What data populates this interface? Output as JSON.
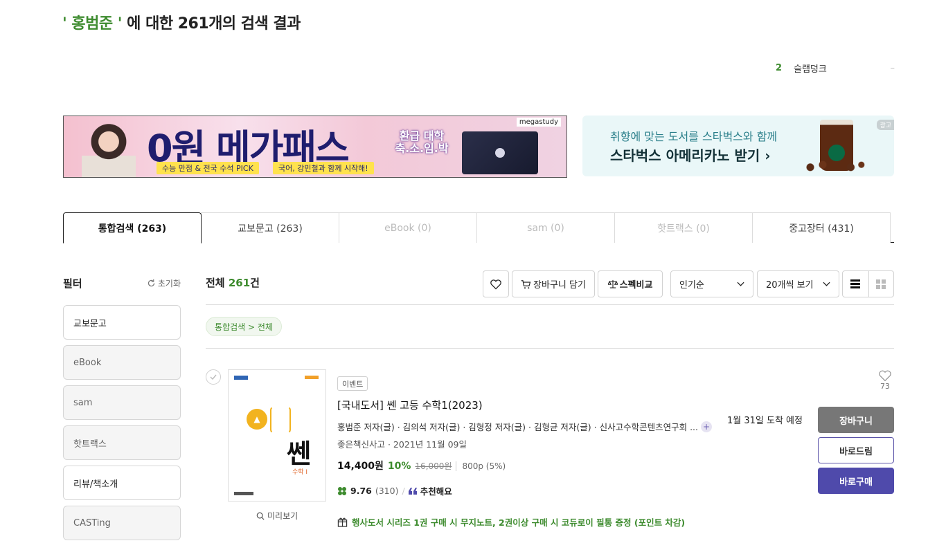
{
  "search": {
    "title_keyword": "' 홍범준 '",
    "title_rest": " 에 대한 261개의 검색 결과"
  },
  "rank": {
    "number": "2",
    "word": "슬램덩크",
    "trend": "–"
  },
  "banners": {
    "left": {
      "headline": "0원 메가패스",
      "pill1": "수능 만점 & 전국 수석 PICK",
      "pill2": "국어, 강민철과 함께 시작해!",
      "side_text": "환급 대학 축.소.임.박",
      "brand": "megastudy"
    },
    "right": {
      "line1": "취향에 맞는 도서를 스타벅스와 함께",
      "line2": "스타벅스 아메리카노 받기 ›",
      "ad_label": "광고"
    }
  },
  "tabs": [
    {
      "label": "통합검색 (263)",
      "state": "active"
    },
    {
      "label": "교보문고 (263)",
      "state": "normal"
    },
    {
      "label": "eBook (0)",
      "state": "disabled"
    },
    {
      "label": "sam (0)",
      "state": "disabled"
    },
    {
      "label": "핫트랙스 (0)",
      "state": "disabled"
    },
    {
      "label": "중고장터 (431)",
      "state": "normal"
    }
  ],
  "filter": {
    "title": "필터",
    "reset": "초기화",
    "items": [
      "교보문고",
      "eBook",
      "sam",
      "핫트랙스",
      "리뷰/책소개",
      "CASTing"
    ]
  },
  "results": {
    "total_prefix": "전체 ",
    "total_count": "261",
    "total_suffix": "건",
    "cart_label": "장바구니 담기",
    "compare_label": "스펙비교",
    "sort_value": "인기순",
    "count_value": "20개씩 보기",
    "breadcrumb": "통합검색 > 전체"
  },
  "product": {
    "badge": "이벤트",
    "title": "[국내도서] 쎈 고등 수학1(2023)",
    "authors": "홍범준 저자(글) · 김의석 저자(글) · 김형정 저자(글) · 김형균 저자(글) · 신사고수학콘텐츠연구회 ...",
    "publisher_date": "좋은책신사고 · 2021년 11월 09일",
    "sale_price": "14,400원",
    "discount": "10%",
    "original_price": "16,000원",
    "points": "800p (5%)",
    "rating": "9.76",
    "rating_count": "(310)",
    "recommend": "추천해요",
    "promo": "행사도서 시리즈 1권 구매 시 무지노트, 2권이상 구매 시 코듀로이 필통 증정 (포인트 차감)",
    "preview": "미리보기",
    "delivery": "1월 31일 도착 예정",
    "likes": "73",
    "btn_cart": "장바구니",
    "btn_direct": "바로드림",
    "btn_buy": "바로구매",
    "cover_title": "쎈",
    "cover_sub": "수학 I"
  },
  "colors": {
    "accent_green": "#3d8b2e",
    "purple": "#4f4aab"
  }
}
